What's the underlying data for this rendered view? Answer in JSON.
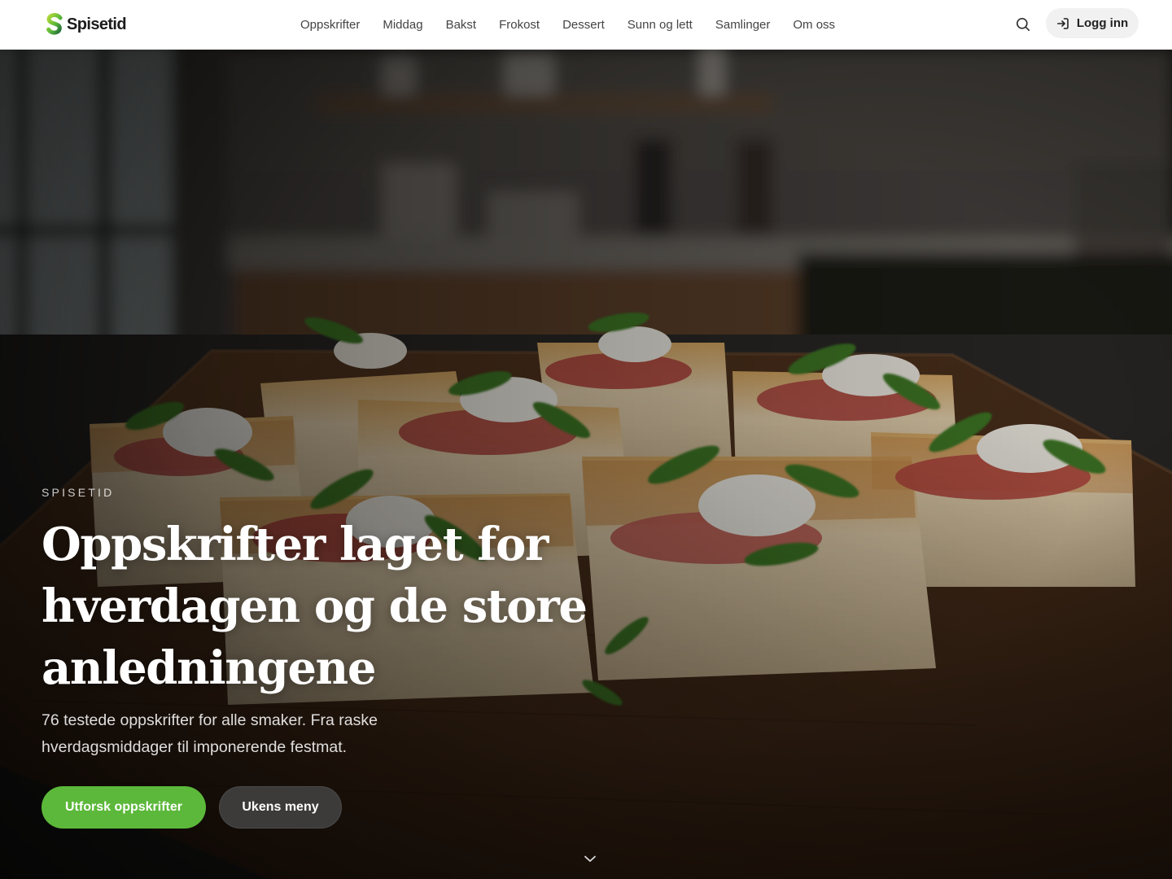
{
  "brand": {
    "name": "Spisetid",
    "accent_color": "#5cb83a"
  },
  "header": {
    "nav": [
      {
        "label": "Oppskrifter"
      },
      {
        "label": "Middag"
      },
      {
        "label": "Bakst"
      },
      {
        "label": "Frokost"
      },
      {
        "label": "Dessert"
      },
      {
        "label": "Sunn og lett"
      },
      {
        "label": "Samlinger"
      },
      {
        "label": "Om oss"
      }
    ],
    "search_icon": "search-icon",
    "login": {
      "icon": "login-arrow-icon",
      "label": "Logg inn"
    }
  },
  "hero": {
    "eyebrow": "SPISETID",
    "title": "Oppskrifter laget for hverdagen og de store anledningene",
    "subtitle": "76 testede oppskrifter for alle smaker. Fra raske hverdagsmiddager til imponerende festmat.",
    "primary_button": "Utforsk oppskrifter",
    "secondary_button": "Ukens meny",
    "scroll_icon": "chevron-down-icon",
    "image": "focaccia-pizza-slices-on-wooden-board"
  }
}
